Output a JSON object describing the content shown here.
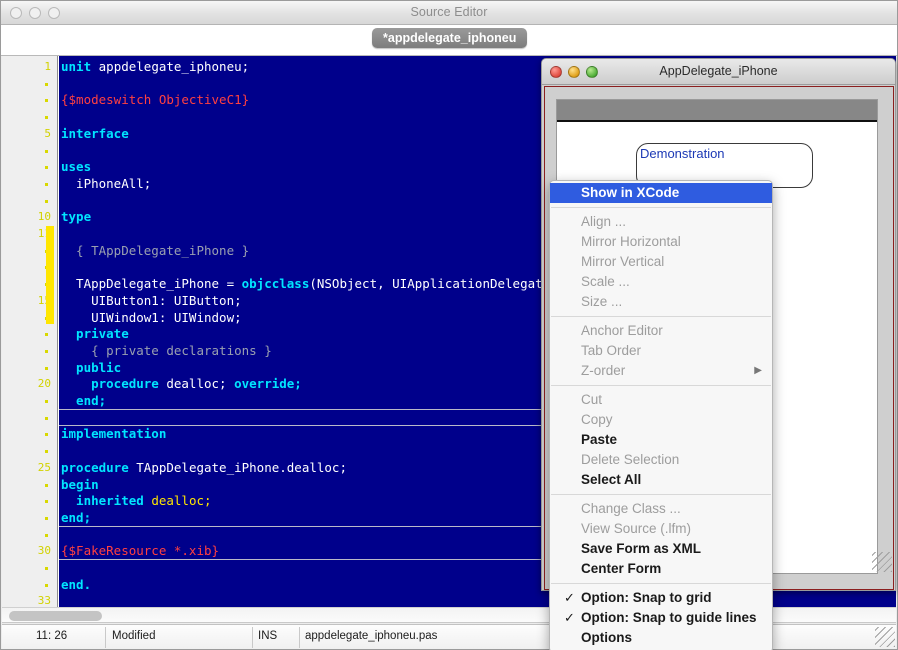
{
  "window": {
    "title": "Source Editor",
    "traffic_buttons": [
      "close",
      "minimize",
      "zoom"
    ],
    "tab_label": "*appdelegate_iphoneu"
  },
  "editor": {
    "gutter": {
      "numbered_lines": [
        1,
        5,
        10,
        11,
        15,
        20,
        25,
        30,
        33
      ],
      "total_lines": 33,
      "change_bar_color": "#ffe600",
      "number_color": "#d2d200"
    },
    "background_color": "#00008b",
    "lines": [
      {
        "n": 1,
        "tokens": [
          {
            "t": "unit ",
            "c": "k"
          },
          {
            "t": "appdelegate_iphoneu;",
            "c": "i"
          }
        ]
      },
      {
        "n": 2,
        "tokens": []
      },
      {
        "n": 3,
        "tokens": [
          {
            "t": "{$modeswitch ObjectiveC1}",
            "c": "c"
          }
        ]
      },
      {
        "n": 4,
        "tokens": []
      },
      {
        "n": 5,
        "tokens": [
          {
            "t": "interface",
            "c": "k"
          }
        ]
      },
      {
        "n": 6,
        "tokens": []
      },
      {
        "n": 7,
        "tokens": [
          {
            "t": "uses",
            "c": "k"
          }
        ]
      },
      {
        "n": 8,
        "tokens": [
          {
            "t": "  iPhoneAll;",
            "c": "i"
          }
        ]
      },
      {
        "n": 9,
        "tokens": []
      },
      {
        "n": 10,
        "tokens": [
          {
            "t": "type",
            "c": "k"
          }
        ]
      },
      {
        "n": 11,
        "tokens": []
      },
      {
        "n": 12,
        "tokens": [
          {
            "t": "  { TAppDelegate_iPhone }",
            "c": "g"
          }
        ]
      },
      {
        "n": 13,
        "tokens": []
      },
      {
        "n": 14,
        "tokens": [
          {
            "t": "  TAppDelegate_iPhone = ",
            "c": "i"
          },
          {
            "t": "objcclass",
            "c": "k"
          },
          {
            "t": "(NSObject, UIApplicationDelegateProt",
            "c": "i"
          }
        ]
      },
      {
        "n": 15,
        "tokens": [
          {
            "t": "    UIButton1: UIButton;",
            "c": "i"
          }
        ]
      },
      {
        "n": 16,
        "tokens": [
          {
            "t": "    UIWindow1: UIWindow;",
            "c": "i"
          }
        ]
      },
      {
        "n": 17,
        "tokens": [
          {
            "t": "  private",
            "c": "k"
          }
        ]
      },
      {
        "n": 18,
        "tokens": [
          {
            "t": "    { private declarations }",
            "c": "g"
          }
        ]
      },
      {
        "n": 19,
        "tokens": [
          {
            "t": "  public",
            "c": "k"
          }
        ]
      },
      {
        "n": 20,
        "tokens": [
          {
            "t": "    procedure ",
            "c": "k"
          },
          {
            "t": "dealloc; ",
            "c": "i"
          },
          {
            "t": "override;",
            "c": "k"
          }
        ]
      },
      {
        "n": 21,
        "tokens": [
          {
            "t": "  end;",
            "c": "k"
          }
        ]
      },
      {
        "n": 22,
        "tokens": []
      },
      {
        "n": 23,
        "tokens": [
          {
            "t": "implementation",
            "c": "k"
          }
        ]
      },
      {
        "n": 24,
        "tokens": []
      },
      {
        "n": 25,
        "tokens": [
          {
            "t": "procedure ",
            "c": "k"
          },
          {
            "t": "TAppDelegate_iPhone.dealloc;",
            "c": "i"
          }
        ]
      },
      {
        "n": 26,
        "tokens": [
          {
            "t": "begin",
            "c": "k"
          }
        ]
      },
      {
        "n": 27,
        "tokens": [
          {
            "t": "  inherited ",
            "c": "k"
          },
          {
            "t": "dealloc;",
            "c": "y"
          }
        ]
      },
      {
        "n": 28,
        "tokens": [
          {
            "t": "end;",
            "c": "k"
          }
        ]
      },
      {
        "n": 29,
        "tokens": []
      },
      {
        "n": 30,
        "tokens": [
          {
            "t": "{$FakeResource *.xib}",
            "c": "c"
          }
        ]
      },
      {
        "n": 31,
        "tokens": []
      },
      {
        "n": 32,
        "tokens": [
          {
            "t": "end.",
            "c": "k"
          }
        ]
      },
      {
        "n": 33,
        "tokens": []
      }
    ]
  },
  "statusbar": {
    "cursor_position": "11: 26",
    "modified": "Modified",
    "insert_mode": "INS",
    "filename": "appdelegate_iphoneu.pas"
  },
  "form_window": {
    "title": "AppDelegate_iPhone",
    "traffic_buttons": [
      "close",
      "minimize",
      "zoom"
    ],
    "button_label": "Demonstration"
  },
  "context_menu": {
    "items": [
      {
        "label": "Show in XCode",
        "state": "selected"
      },
      {
        "type": "separator"
      },
      {
        "label": "Align ...",
        "state": "disabled"
      },
      {
        "label": "Mirror Horizontal",
        "state": "disabled"
      },
      {
        "label": "Mirror Vertical",
        "state": "disabled"
      },
      {
        "label": "Scale ...",
        "state": "disabled"
      },
      {
        "label": "Size ...",
        "state": "disabled"
      },
      {
        "type": "separator"
      },
      {
        "label": "Anchor Editor",
        "state": "disabled"
      },
      {
        "label": "Tab Order",
        "state": "disabled"
      },
      {
        "label": "Z-order",
        "state": "disabled",
        "submenu": true
      },
      {
        "type": "separator"
      },
      {
        "label": "Cut",
        "state": "disabled"
      },
      {
        "label": "Copy",
        "state": "disabled"
      },
      {
        "label": "Paste",
        "state": "enabled"
      },
      {
        "label": "Delete Selection",
        "state": "disabled"
      },
      {
        "label": "Select All",
        "state": "enabled"
      },
      {
        "type": "separator"
      },
      {
        "label": "Change Class ...",
        "state": "disabled"
      },
      {
        "label": "View Source (.lfm)",
        "state": "disabled"
      },
      {
        "label": "Save Form as XML",
        "state": "enabled"
      },
      {
        "label": "Center Form",
        "state": "enabled"
      },
      {
        "type": "separator"
      },
      {
        "label": "Option: Snap to grid",
        "state": "enabled",
        "checked": true
      },
      {
        "label": "Option: Snap to guide lines",
        "state": "enabled",
        "checked": true
      },
      {
        "label": "Options",
        "state": "enabled"
      }
    ],
    "check_glyph": "✓",
    "submenu_glyph": "▶",
    "highlight_color": "#2f5ce0"
  }
}
